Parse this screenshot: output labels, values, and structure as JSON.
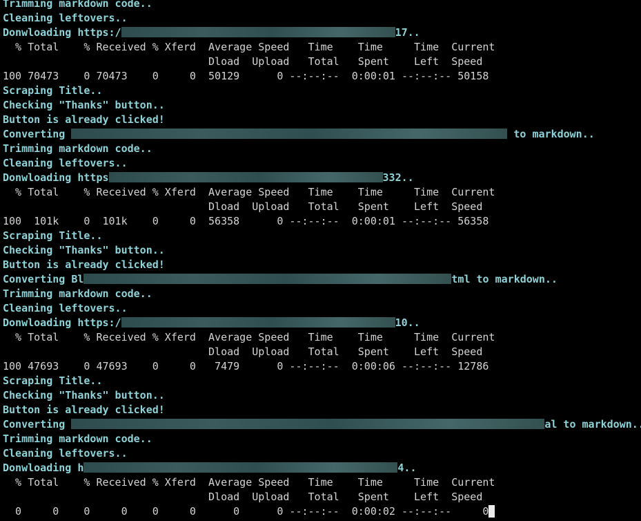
{
  "colors": {
    "background": "#000000",
    "status_text": "#8fd2d8",
    "progress_text": "#d4d4d4",
    "redaction": "#3a5a5c",
    "cursor": "#ececec"
  },
  "terminal": {
    "lines": {
      "l0": "Trimming markdown code..",
      "l1": "Cleaning leftovers..",
      "l2a": "Donwloading https:/",
      "l2b": "17..",
      "l3": "  % Total    % Received % Xferd  Average Speed   Time    Time     Time  Current",
      "l4": "                                 Dload  Upload   Total   Spent    Left  Speed",
      "l5": "100 70473    0 70473    0     0  50129      0 --:--:--  0:00:01 --:--:-- 50158",
      "l6": "Scraping Title..",
      "l7": "Checking \"Thanks\" button..",
      "l8": "Button is already clicked!",
      "l9a": "Converting ",
      "l9b": " to markdown..",
      "l10": "Trimming markdown code..",
      "l11": "Cleaning leftovers..",
      "l12a": "Donwloading https",
      "l12b": "332..",
      "l13": "  % Total    % Received % Xferd  Average Speed   Time    Time     Time  Current",
      "l14": "                                 Dload  Upload   Total   Spent    Left  Speed",
      "l15": "100  101k    0  101k    0     0  56358      0 --:--:--  0:00:01 --:--:-- 56358",
      "l16": "Scraping Title..",
      "l17": "Checking \"Thanks\" button..",
      "l18": "Button is already clicked!",
      "l19a": "Converting Bl",
      "l19b": "tml to markdown..",
      "l20": "Trimming markdown code..",
      "l21": "Cleaning leftovers..",
      "l22a": "Donwloading https:/",
      "l22b": "10..",
      "l23": "  % Total    % Received % Xferd  Average Speed   Time    Time     Time  Current",
      "l24": "                                 Dload  Upload   Total   Spent    Left  Speed",
      "l25": "100 47693    0 47693    0     0   7479      0 --:--:--  0:00:06 --:--:-- 12786",
      "l26": "Scraping Title..",
      "l27": "Checking \"Thanks\" button..",
      "l28": "Button is already clicked!",
      "l29a": "Converting ",
      "l29b": "al to markdown..",
      "l30": "Trimming markdown code..",
      "l31": "Cleaning leftovers..",
      "l32a": "Donwloading h",
      "l32b": "4..",
      "l33": "  % Total    % Received % Xferd  Average Speed   Time    Time     Time  Current",
      "l34": "                                 Dload  Upload   Total   Spent    Left  Speed",
      "l35": "  0     0    0     0    0     0      0      0 --:--:--  0:00:02 --:--:--     0"
    }
  }
}
